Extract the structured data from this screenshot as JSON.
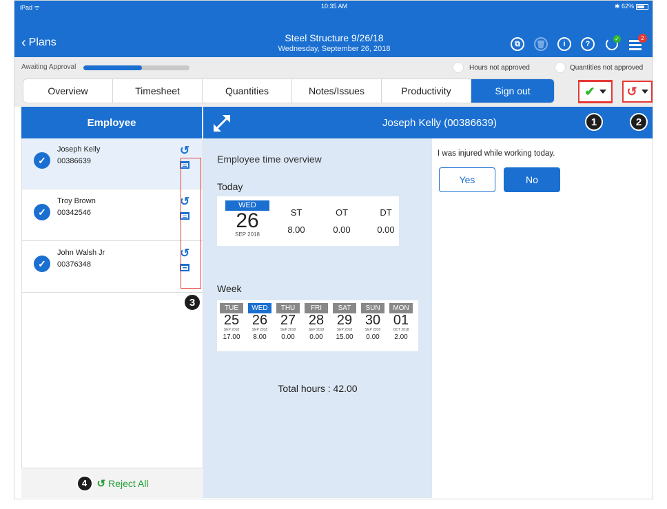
{
  "status_bar": {
    "left": "iPad ᯤ",
    "time": "10:35 AM",
    "right": "✱ 62%"
  },
  "nav": {
    "back_label": "Plans",
    "title": "Steel Structure 9/26/18",
    "subtitle": "Wednesday, September 26, 2018",
    "icons": [
      "copy-icon",
      "delete-icon",
      "info-icon",
      "help-icon",
      "sync-icon",
      "menu-icon"
    ],
    "menu_badge": "2",
    "accent_color": "#1a6fd1"
  },
  "approval": {
    "label": "Awaiting Approval",
    "progress_fraction": 0.55,
    "legend": [
      "Hours not approved",
      "Quantities not approved"
    ]
  },
  "tabs": [
    "Overview",
    "Timesheet",
    "Quantities",
    "Notes/Issues",
    "Productivity",
    "Sign out"
  ],
  "active_tab": "Sign out",
  "callouts": [
    "1",
    "2",
    "3",
    "4"
  ],
  "employee_panel": {
    "header": "Employee",
    "employees": [
      {
        "name": "Joseph Kelly",
        "id": "00386639",
        "selected": true
      },
      {
        "name": "Troy Brown",
        "id": "00342546",
        "selected": false
      },
      {
        "name": "John Walsh Jr",
        "id": "00376348",
        "selected": false
      }
    ],
    "reject_all_label": "Reject All"
  },
  "detail": {
    "header_name": "Joseph Kelly (00386639)",
    "overview_title": "Employee time overview",
    "today_label": "Today",
    "today": {
      "dow": "WED",
      "day": "26",
      "month_year": "SEP 2018",
      "columns": [
        {
          "label": "ST",
          "value": "8.00"
        },
        {
          "label": "OT",
          "value": "0.00"
        },
        {
          "label": "DT",
          "value": "0.00"
        }
      ]
    },
    "week_label": "Week",
    "week": [
      {
        "dow": "TUE",
        "day": "25",
        "month_year": "SEP 2018",
        "hours": "17.00"
      },
      {
        "dow": "WED",
        "day": "26",
        "month_year": "SEP 2018",
        "hours": "8.00"
      },
      {
        "dow": "THU",
        "day": "27",
        "month_year": "SEP 2018",
        "hours": "0.00"
      },
      {
        "dow": "FRI",
        "day": "28",
        "month_year": "SEP 2018",
        "hours": "0.00"
      },
      {
        "dow": "SAT",
        "day": "29",
        "month_year": "SEP 2018",
        "hours": "15.00"
      },
      {
        "dow": "SUN",
        "day": "30",
        "month_year": "SEP 2018",
        "hours": "0.00"
      },
      {
        "dow": "MON",
        "day": "01",
        "month_year": "OCT 2018",
        "hours": "2.00"
      }
    ],
    "total_hours": "Total hours : 42.00"
  },
  "injury": {
    "question": "I was injured while working today.",
    "yes_label": "Yes",
    "no_label": "No",
    "selected": "No"
  }
}
